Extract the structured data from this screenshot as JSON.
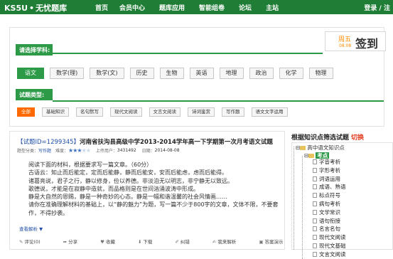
{
  "header": {
    "logo_brand": "KS5U",
    "logo_dot": "•",
    "logo_name": "无忧题库",
    "nav": [
      "首页",
      "会员中心",
      "题库应用",
      "智能组卷",
      "论坛",
      "主站"
    ],
    "login": "登录",
    "sep": "/",
    "register": "注"
  },
  "subject_section": {
    "title": "请选择学科:",
    "subjects": [
      "语文",
      "数学(理)",
      "数学(文)",
      "历史",
      "生物",
      "英语",
      "地理",
      "政治",
      "化学",
      "物理"
    ],
    "active_subject": "语文"
  },
  "sign": {
    "week": "周五",
    "date": "08.08",
    "button": "签到"
  },
  "type_section": {
    "title": "试题类型:",
    "types": [
      "全部",
      "基础知识",
      "名句默写",
      "现代文阅读",
      "文言文阅读",
      "诗词鉴赏",
      "写作题",
      "语文文字运用"
    ],
    "active_type": "全部"
  },
  "question": {
    "id": "【试题ID=1299345】",
    "title": "河南省扶沟县高级中学2013-2014学年高一下学期第一次月考语文试题",
    "type_label": "题型分类：",
    "type_value": "写作题",
    "difficulty_label": "难度：",
    "difficulty": 3,
    "upload_user_label": "上传用户：",
    "upload_user": "3431492",
    "date_label": "日期：",
    "date": "2014-08-08",
    "body": [
      "阅读下面的材料，根据要求写一篇文章。（60分）",
      "古语云：知止而后能定，定而后能静，静而后能安，安而后能虑，虑而后能得。",
      "诸葛亮说，君子之行，静以修身，俭以养德。非淡泊无以明志，非宁静无以致远。",
      "歌德说，才能是在寂静中造就，而品格则是在世间汹涌波涛中形成。",
      "静是大自然的恩赐，静是一种奇妙的心态。静是一幅和谐温馨的社会风情画……",
      "请你在准确理解材料的基础上，以“静的魅力”为题，写一篇不少于800字的文章，文体不限，不要套作，不得抄袭。"
    ],
    "view_link": "查看解析",
    "actions": [
      "评论(0)",
      "分享",
      "收藏",
      "下载",
      "纠错",
      "我来解析",
      "答案演示"
    ]
  },
  "tree": {
    "header": "根据知识点筛选试题",
    "switch": "切换",
    "root": "高中语文知识点",
    "kaodian": "考点",
    "leaves": [
      "字音考析",
      "字形考析",
      "词语运用",
      "成语、熟语",
      "标点符号",
      "病句考析",
      "文学常识",
      "语句衔接",
      "名言名句",
      "现代文阅读",
      "现代文基础",
      "文言文阅读"
    ]
  }
}
